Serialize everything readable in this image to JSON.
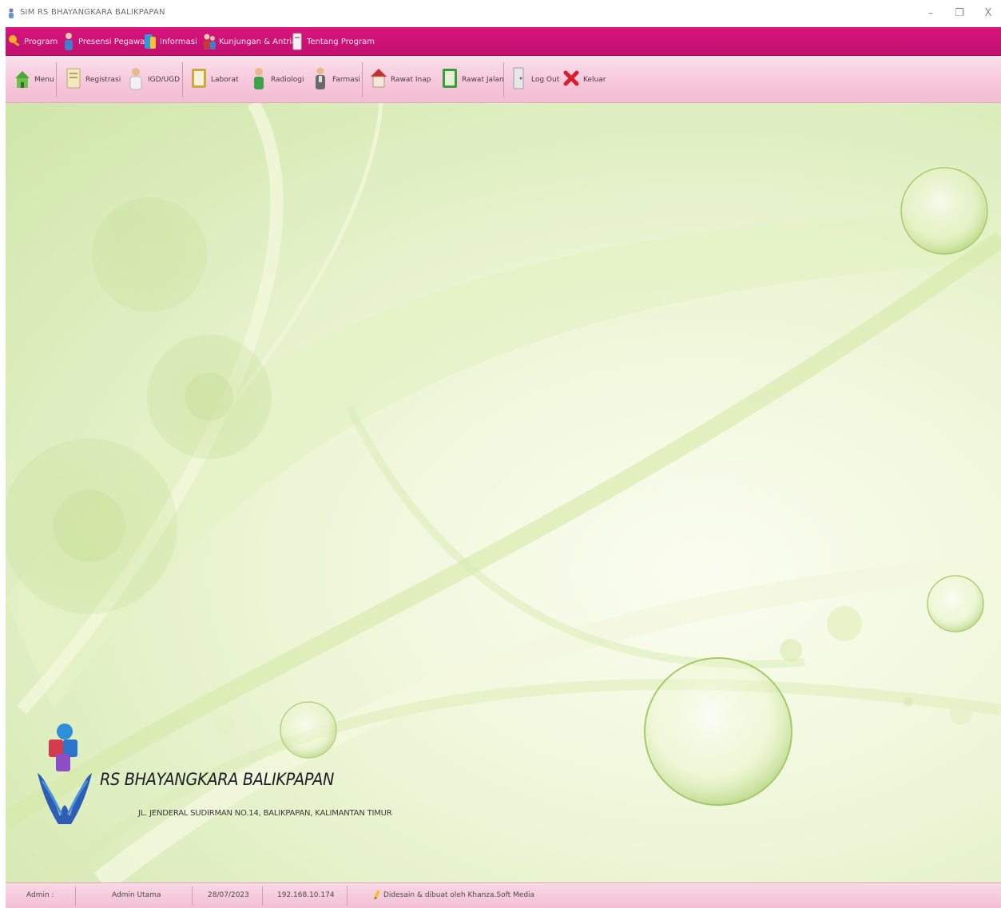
{
  "window": {
    "title": "SIM RS BHAYANGKARA BALIKPAPAN",
    "minimize_label": "–",
    "restore_label": "❐",
    "close_label": "X"
  },
  "menubar": {
    "items": [
      {
        "label": "Program",
        "icon": "key-icon"
      },
      {
        "label": "Presensi Pegawai",
        "icon": "person-icon"
      },
      {
        "label": "Informasi",
        "icon": "info-icon"
      },
      {
        "label": "Kunjungan & Antrian",
        "icon": "people-icon"
      },
      {
        "label": "Tentang Program",
        "icon": "document-icon"
      }
    ]
  },
  "toolbar": {
    "items": [
      {
        "label": "Menu",
        "icon": "home-icon"
      },
      {
        "label": "Registrasi",
        "icon": "registration-icon"
      },
      {
        "label": "IGD/UGD",
        "icon": "doctor-icon"
      },
      {
        "label": "Laborat",
        "icon": "laboratory-icon"
      },
      {
        "label": "Radiologi",
        "icon": "radiology-icon"
      },
      {
        "label": "Farmasi",
        "icon": "pharmacy-icon"
      },
      {
        "label": "Rawat Inap",
        "icon": "inpatient-icon"
      },
      {
        "label": "Rawat Jalan",
        "icon": "outpatient-icon"
      },
      {
        "label": "Log Out",
        "icon": "logout-icon"
      },
      {
        "label": "Keluar",
        "icon": "close-icon"
      }
    ]
  },
  "brand": {
    "name": "RS BHAYANGKARA BALIKPAPAN",
    "address": "JL. JENDERAL SUDIRMAN NO.14, BALIKPAPAN, KALIMANTAN TIMUR"
  },
  "statusbar": {
    "user_label": "Admin :",
    "user_name": "Admin Utama",
    "date": "28/07/2023",
    "ip": "192.168.10.174",
    "credit": "Didesain & dibuat oleh Khanza.Soft Media"
  },
  "colors": {
    "menubar": "#d8147c",
    "toolbar": "#f6c6da",
    "statusbar": "#f3bfd3",
    "desktop": "#e4f0c6"
  }
}
